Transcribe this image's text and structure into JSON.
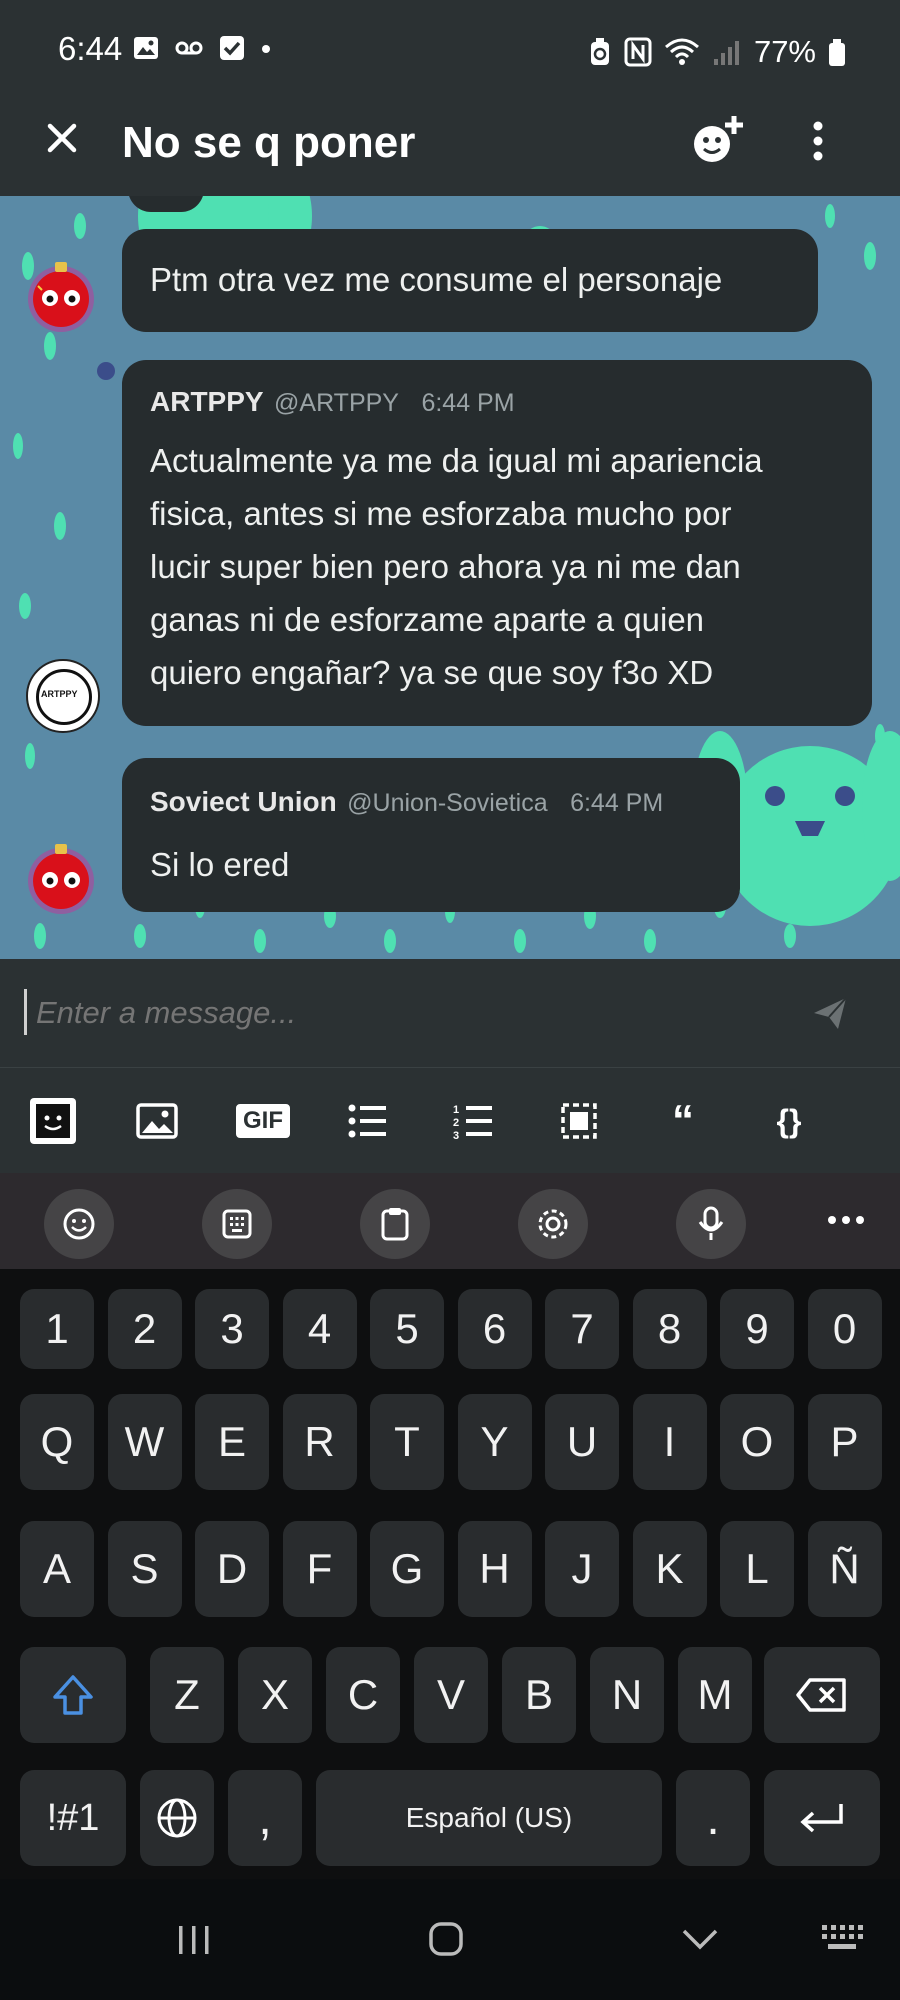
{
  "status_bar": {
    "time": "6:44",
    "battery": "77%"
  },
  "header": {
    "title": "No se q poner"
  },
  "messages": [
    {
      "text": "Ptm otra vez me consume el personaje"
    },
    {
      "author": "ARTPPY",
      "handle": "@ARTPPY",
      "time": "6:44 PM",
      "lines": [
        "Actualmente ya me da igual mi apariencia",
        "fisica, antes si me esforzaba mucho por",
        "lucir super bien pero ahora ya ni me dan",
        "ganas ni de esforzame aparte a quien",
        "quiero engañar? ya se que soy f3o XD"
      ],
      "avatar_label": "ARTPPY"
    },
    {
      "author": "Soviect Union",
      "handle": "@Union-Sovietica",
      "time": "6:44 PM",
      "text": "Si lo ered"
    }
  ],
  "composer": {
    "placeholder": "Enter a message..."
  },
  "toolbar": {
    "gif_label": "GIF",
    "quote_label": "“",
    "code_label": "{}"
  },
  "keyboard": {
    "row_numbers": [
      "1",
      "2",
      "3",
      "4",
      "5",
      "6",
      "7",
      "8",
      "9",
      "0"
    ],
    "row_q": [
      "Q",
      "W",
      "E",
      "R",
      "T",
      "Y",
      "U",
      "I",
      "O",
      "P"
    ],
    "row_a": [
      "A",
      "S",
      "D",
      "F",
      "G",
      "H",
      "J",
      "K",
      "L",
      "Ñ"
    ],
    "row_z": [
      "Z",
      "X",
      "C",
      "V",
      "B",
      "N",
      "M"
    ],
    "symbols_label": "!#1",
    "comma_label": ",",
    "space_label": "Español (US)",
    "period_label": "."
  },
  "colors": {
    "bubble": "#262c2e",
    "chat_bg": "#5a8aa6",
    "dots": "#4fe0b2",
    "bar": "#2b3133"
  }
}
